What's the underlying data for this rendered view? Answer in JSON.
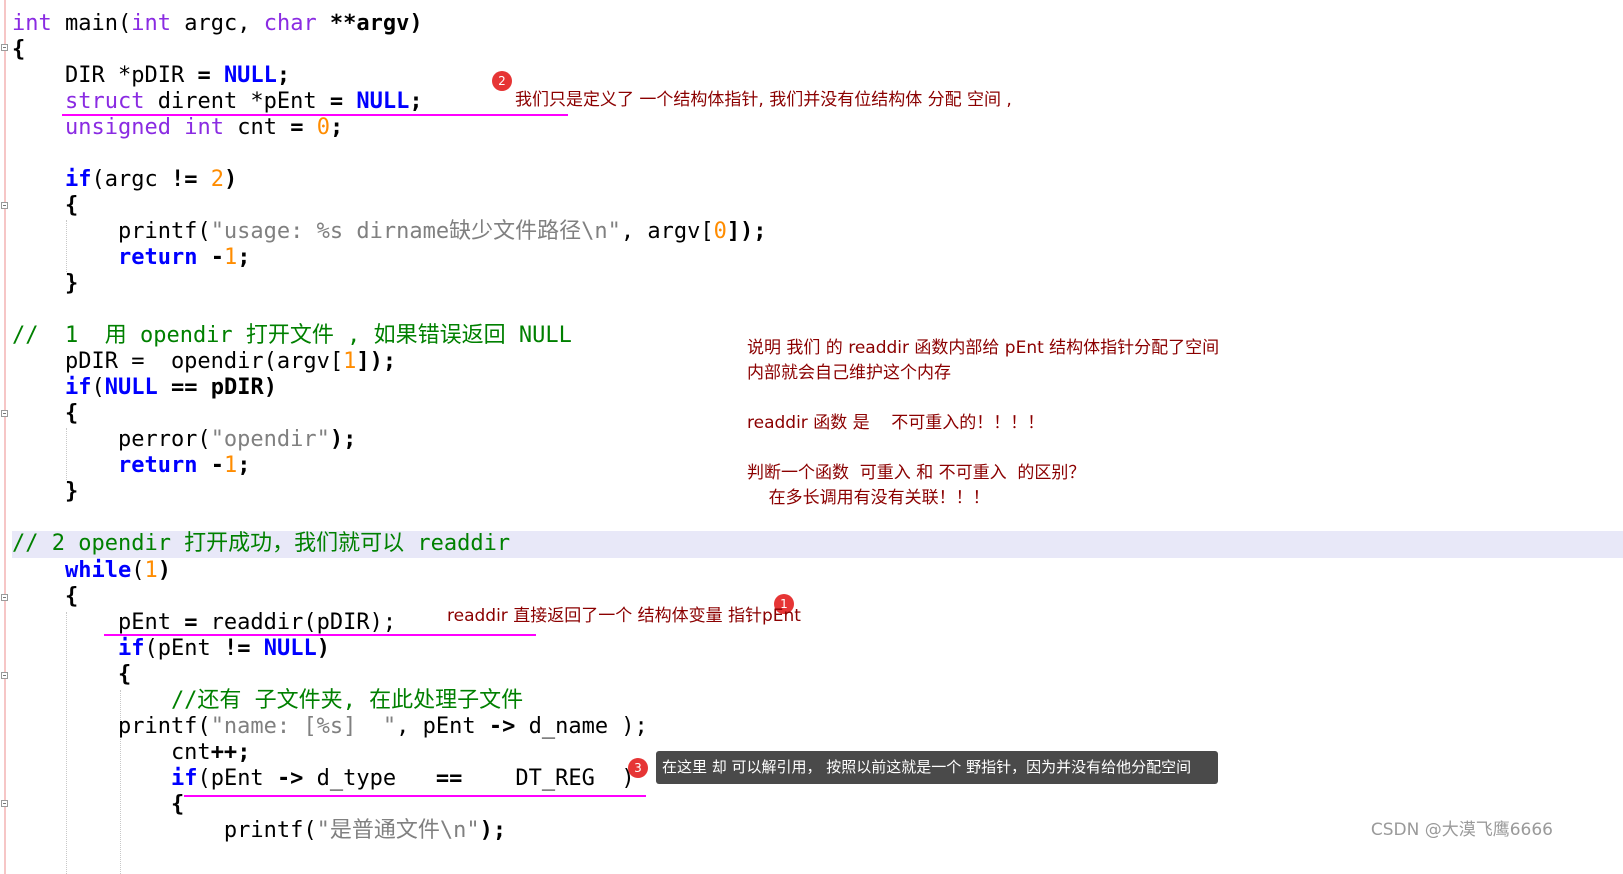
{
  "code": {
    "line1": {
      "t1": "int",
      "t2": " main(",
      "t3": "int",
      "t4": " argc, ",
      "t5": "char",
      "t6": " **argv)"
    },
    "line2": "{",
    "line3": {
      "t1": "    DIR *pDIR ",
      "t2": "=",
      "t3": " ",
      "t4": "NULL",
      "t5": ";"
    },
    "line4": {
      "t1": "    ",
      "t2": "struct",
      "t3": " dirent *pEnt ",
      "t4": "=",
      "t5": " ",
      "t6": "NULL",
      "t7": ";"
    },
    "line5": {
      "t1": "    ",
      "t2": "unsigned",
      "t3": " ",
      "t4": "int",
      "t5": " cnt ",
      "t6": "=",
      "t7": " ",
      "t8": "0",
      "t9": ";"
    },
    "line6": {
      "t1": "    ",
      "t2": "if",
      "t3": "(argc ",
      "t4": "!=",
      "t5": " ",
      "t6": "2",
      "t7": ")"
    },
    "line7": "    {",
    "line8": {
      "t1": "        printf(",
      "t2": "\"usage: %s dirname缺少文件路径\\n\"",
      "t3": ", argv[",
      "t4": "0",
      "t5": "]);"
    },
    "line9": {
      "t1": "        ",
      "t2": "return",
      "t3": " -",
      "t4": "1",
      "t5": ";"
    },
    "line10": "    }",
    "line11": "//  1  用 opendir 打开文件 , 如果错误返回 NULL",
    "line12": {
      "t1": "    pDIR =  opendir(argv[",
      "t2": "1",
      "t3": "]);"
    },
    "line13": {
      "t1": "    ",
      "t2": "if",
      "t3": "(",
      "t4": "NULL",
      "t5": " ",
      "t6": "==",
      "t7": " pDIR)"
    },
    "line14": "    {",
    "line15": {
      "t1": "        perror(",
      "t2": "\"opendir\"",
      "t3": ");"
    },
    "line16": {
      "t1": "        ",
      "t2": "return",
      "t3": " -",
      "t4": "1",
      "t5": ";"
    },
    "line17": "    }",
    "line18": "// 2 opendir 打开成功，我们就可以 readdir",
    "line19": {
      "t1": "    ",
      "t2": "while",
      "t3": "(",
      "t4": "1",
      "t5": ")"
    },
    "line20": "    {",
    "line21": {
      "t1": "        pEnt ",
      "t2": "=",
      "t3": " readdir(pDIR);"
    },
    "line22": {
      "t1": "        ",
      "t2": "if",
      "t3": "(pEnt ",
      "t4": "!=",
      "t5": " ",
      "t6": "NULL",
      "t7": ")"
    },
    "line23": "        {",
    "line24": "            //还有 子文件夹, 在此处理子文件",
    "line25": {
      "t1": "        printf(",
      "t2": "\"name: [%s]  \"",
      "t3": ", pEnt ",
      "t4": "->",
      "t5": " d_name );"
    },
    "line26": {
      "t1": "            cnt",
      "t2": "++",
      "t3": ";"
    },
    "line27": {
      "t1": "            ",
      "t2": "if",
      "t3": "(pEnt ",
      "t4": "->",
      "t5": " d_type   ",
      "t6": "==",
      "t7": "    DT_REG  )"
    },
    "line28": "            {",
    "line29": {
      "t1": "                printf(",
      "t2": "\"是普通文件\\n\"",
      "t3": ");"
    }
  },
  "annotations": {
    "note2": "我们只是定义了 一个结构体指针, 我们并没有位结构体 分配 空间 ,",
    "explain1": "说明 我们 的 readdir 函数内部给 pEnt 结构体指针分配了空间",
    "explain2": "内部就会自己维护这个内存",
    "explain3": "readdir 函数 是    不可重入的！！！！",
    "explain4": "判断一个函数  可重入 和 不可重入  的区别？",
    "explain5": "    在多长调用有没有关联！！！",
    "note1": "readdir 直接返回了一个 结构体变量 指针pEnt",
    "tooltip": "在这里 却 可以解引用， 按照以前这就是一个 野指针，因为并没有给他分配空间"
  },
  "badges": {
    "b1": "1",
    "b2": "2",
    "b3": "3"
  },
  "watermark": "CSDN @大漠飞鹰6666",
  "colors": {
    "keyword": "#8a2be2",
    "bold_keyword": "#0000ff",
    "number": "#ff8c00",
    "string": "#808080",
    "comment": "#008000",
    "underline": "#ff00ff",
    "note": "#8b0000",
    "highlight": "#e8e8f8"
  }
}
